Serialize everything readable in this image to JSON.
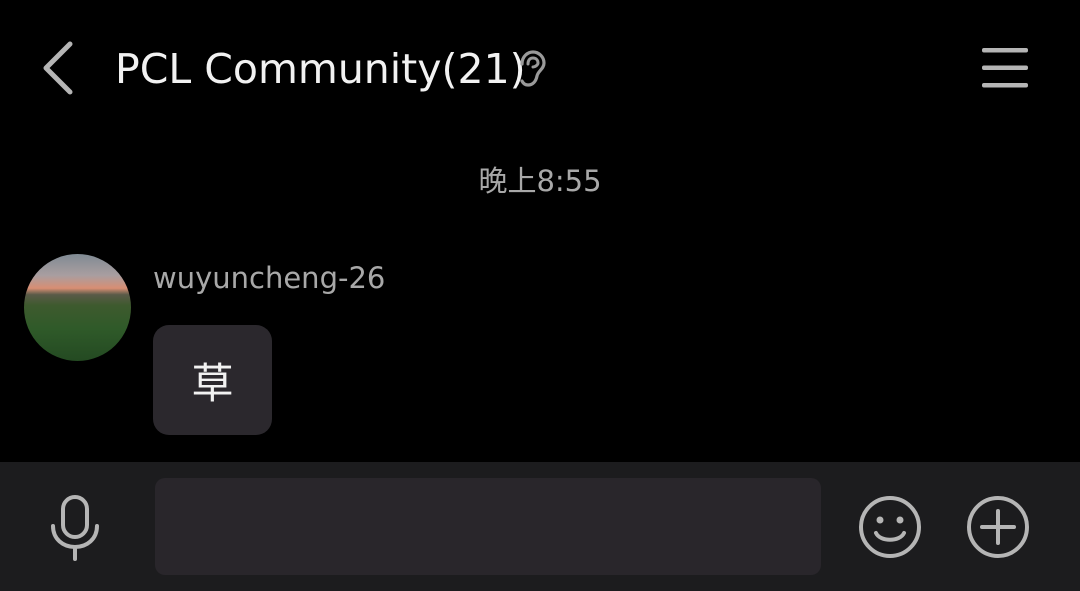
{
  "header": {
    "title": "PCL Community(21)",
    "back_icon": "chevron-left-icon",
    "ear_icon": "ear-icon",
    "menu_icon": "hamburger-menu-icon"
  },
  "chat": {
    "timestamp": "晚上8:55",
    "messages": [
      {
        "sender": "wuyuncheng-26",
        "text": "草"
      }
    ]
  },
  "input_bar": {
    "voice_icon": "microphone-icon",
    "message_value": "",
    "emoji_icon": "smiley-icon",
    "more_icon": "plus-circle-icon"
  },
  "colors": {
    "background": "#000000",
    "bubble": "#2b282d",
    "input_bar": "#1c1c1e",
    "input_field": "#29262b",
    "primary_text": "#f2f2f2",
    "secondary_text": "#a8a8a8",
    "icon": "#b5b5b5"
  }
}
